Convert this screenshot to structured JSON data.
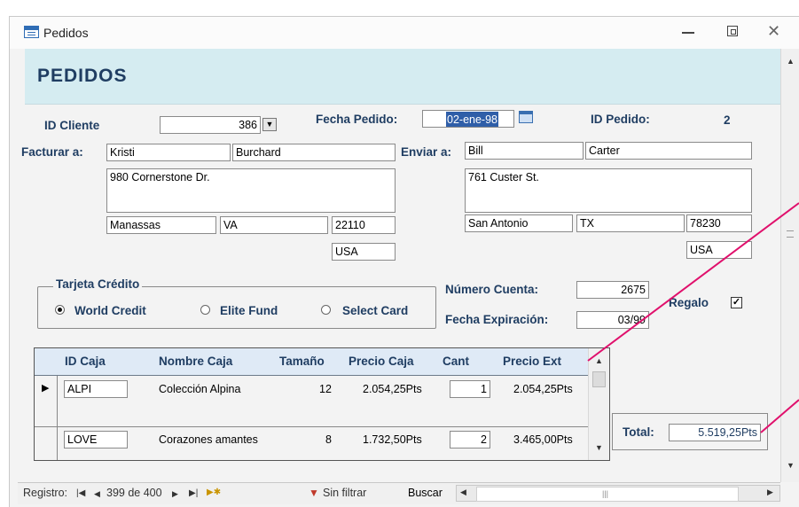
{
  "window": {
    "title": "Pedidos"
  },
  "form": {
    "title": "PEDIDOS",
    "id_cliente_label": "ID Cliente",
    "id_cliente_value": "386",
    "fecha_pedido_label": "Fecha Pedido:",
    "fecha_pedido_value": "02-ene-98",
    "id_pedido_label": "ID Pedido:",
    "id_pedido_value": "2",
    "facturar_label": "Facturar a:",
    "facturar": {
      "first": "Kristi",
      "last": "Burchard",
      "address": "980 Cornerstone Dr.",
      "city": "Manassas",
      "state": "VA",
      "zip": "22110",
      "country": "USA"
    },
    "enviar_label": "Enviar a:",
    "enviar": {
      "first": "Bill",
      "last": "Carter",
      "address": "761 Custer St.",
      "city": "San Antonio",
      "state": "TX",
      "zip": "78230",
      "country": "USA"
    },
    "tarjeta_label": "Tarjeta Crédito",
    "tarjetas": [
      {
        "label": "World Credit",
        "selected": true
      },
      {
        "label": "Elite Fund",
        "selected": false
      },
      {
        "label": "Select Card",
        "selected": false
      }
    ],
    "numero_cuenta_label": "Número Cuenta:",
    "numero_cuenta_value": "2675",
    "fecha_exp_label": "Fecha Expiración:",
    "fecha_exp_value": "03/99",
    "regalo_label": "Regalo",
    "regalo_checked": true,
    "total_label": "Total:",
    "total_value": "5.519,25Pts"
  },
  "subform": {
    "headers": [
      "ID Caja",
      "Nombre Caja",
      "Tamaño",
      "Precio Caja",
      "Cant",
      "Precio Ext"
    ],
    "rows": [
      {
        "id": "ALPI",
        "nombre": "Colección Alpina",
        "tamano": "12",
        "precio": "2.054,25Pts",
        "cant": "1",
        "ext": "2.054,25Pts"
      },
      {
        "id": "LOVE",
        "nombre": "Corazones amantes",
        "tamano": "8",
        "precio": "1.732,50Pts",
        "cant": "2",
        "ext": "3.465,00Pts"
      }
    ]
  },
  "navbar": {
    "registro_label": "Registro:",
    "record_text": "399 de 400",
    "filter_label": "Sin filtrar",
    "search_label": "Buscar"
  },
  "colors": {
    "header_bg": "#d5ecf1",
    "label": "#1f3d62",
    "annotation": "#e0106c"
  }
}
